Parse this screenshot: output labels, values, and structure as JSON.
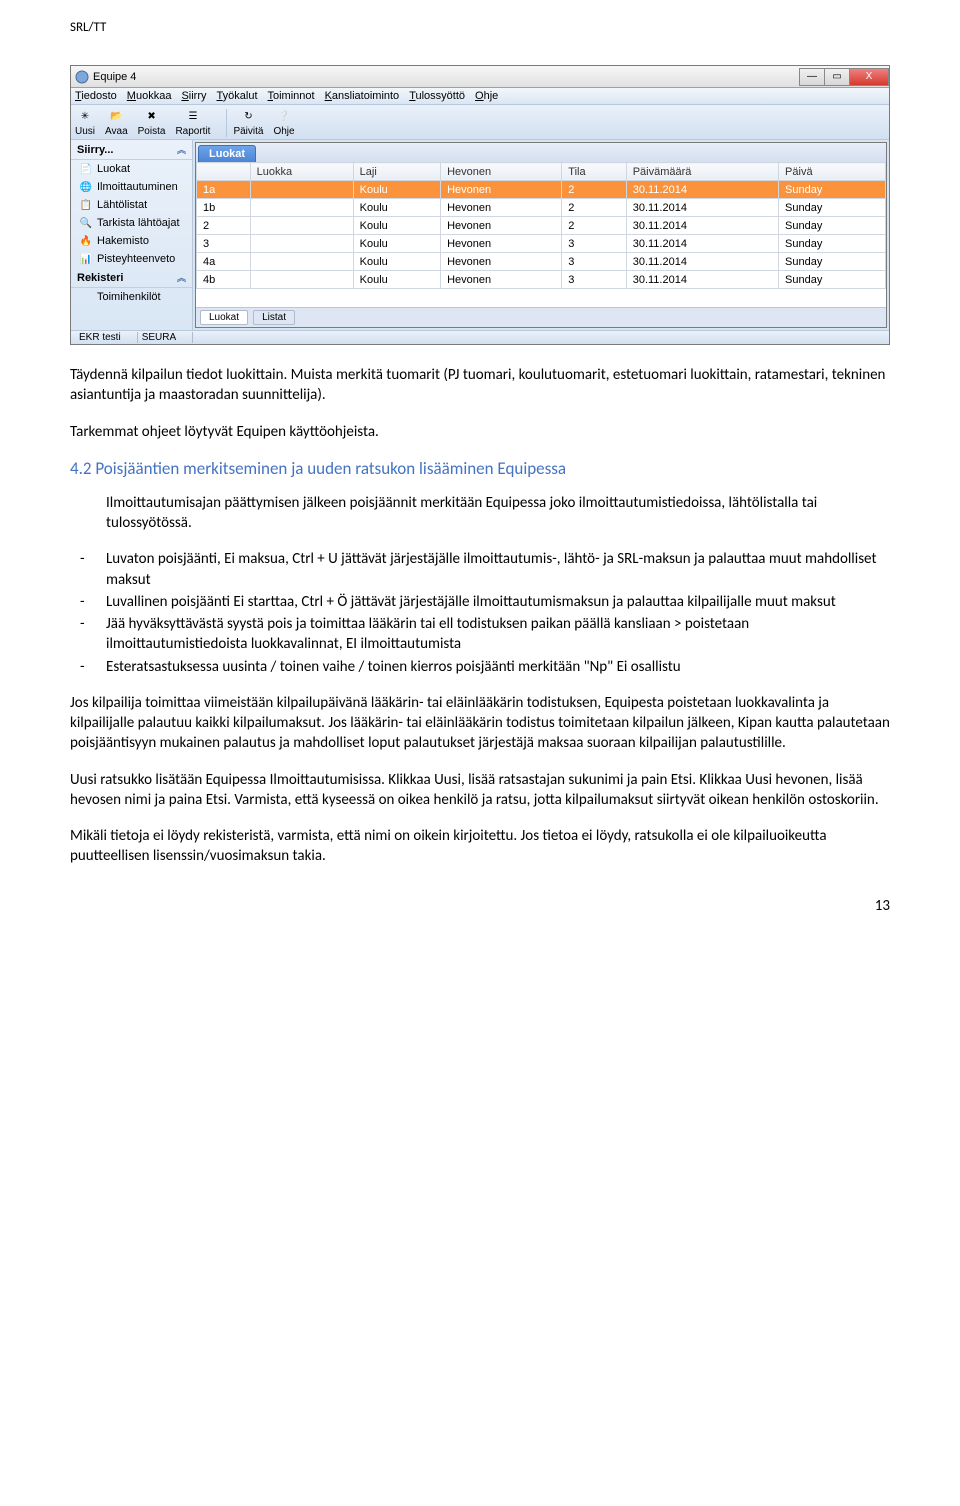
{
  "header_tag": "SRL/TT",
  "window": {
    "title": "Equipe 4",
    "min": "—",
    "max": "▭",
    "close": "X"
  },
  "menubar": [
    {
      "u": "T",
      "rest": "iedosto"
    },
    {
      "u": "M",
      "rest": "uokkaa"
    },
    {
      "u": "S",
      "rest": "iirry"
    },
    {
      "u": "T",
      "rest": "yökalut"
    },
    {
      "u": "T",
      "rest": "oiminnot"
    },
    {
      "u": "K",
      "rest": "ansliatoiminto"
    },
    {
      "u": "T",
      "rest": "ulossyöttö"
    },
    {
      "u": "O",
      "rest": "hje"
    }
  ],
  "toolbar": [
    {
      "label": "Uusi"
    },
    {
      "label": "Avaa"
    },
    {
      "label": "Poista"
    },
    {
      "label": "Raportit"
    },
    {
      "sep": true
    },
    {
      "label": "Päivitä"
    },
    {
      "label": "Ohje"
    }
  ],
  "sidebar": {
    "section1": {
      "title": "Siirry..."
    },
    "items1": [
      {
        "icon": "📄",
        "label": "Luokat"
      },
      {
        "icon": "🌐",
        "label": "Ilmoittautuminen"
      },
      {
        "icon": "📋",
        "label": "Lähtölistat"
      },
      {
        "icon": "🔍",
        "label": "Tarkista lähtöajat"
      },
      {
        "icon": "🔥",
        "label": "Hakemisto"
      },
      {
        "icon": "📊",
        "label": "Pisteyhteenveto"
      }
    ],
    "section2": {
      "title": "Rekisteri"
    },
    "items2": [
      {
        "icon": "",
        "label": "Toimihenkilöt"
      }
    ]
  },
  "main": {
    "tab": "Luokat",
    "footer_tabs": [
      "Luokat",
      "Listat"
    ],
    "columns": [
      "",
      "Luokka",
      "Laji",
      "Hevonen",
      "Tila",
      "Päivämäärä",
      "Päivä"
    ],
    "rows": [
      {
        "n": "1a",
        "luokka": "",
        "laji": "Koulu",
        "hev": "Hevonen",
        "tila": "2",
        "pvm": "30.11.2014",
        "paiva": "Sunday",
        "sel": true
      },
      {
        "n": "1b",
        "luokka": "",
        "laji": "Koulu",
        "hev": "Hevonen",
        "tila": "2",
        "pvm": "30.11.2014",
        "paiva": "Sunday"
      },
      {
        "n": "2",
        "luokka": "",
        "laji": "Koulu",
        "hev": "Hevonen",
        "tila": "2",
        "pvm": "30.11.2014",
        "paiva": "Sunday"
      },
      {
        "n": "3",
        "luokka": "",
        "laji": "Koulu",
        "hev": "Hevonen",
        "tila": "3",
        "pvm": "30.11.2014",
        "paiva": "Sunday"
      },
      {
        "n": "4a",
        "luokka": "",
        "laji": "Koulu",
        "hev": "Hevonen",
        "tila": "3",
        "pvm": "30.11.2014",
        "paiva": "Sunday"
      },
      {
        "n": "4b",
        "luokka": "",
        "laji": "Koulu",
        "hev": "Hevonen",
        "tila": "3",
        "pvm": "30.11.2014",
        "paiva": "Sunday"
      }
    ]
  },
  "statusbar": {
    "left": "EKR testi",
    "right": "SEURA"
  },
  "doc": {
    "p1": "Täydennä kilpailun tiedot luokittain. Muista merkitä tuomarit (PJ tuomari, koulutuomarit, estetuomari luokittain, ratamestari, tekninen asiantuntija ja maastoradan suunnittelija).",
    "p2": "Tarkemmat ohjeet löytyvät Equipen käyttöohjeista.",
    "h1": "4.2 Poisjääntien merkitseminen ja uuden ratsukon lisääminen Equipessa",
    "p3": "Ilmoittautumisajan päättymisen jälkeen poisjäännit merkitään Equipessa joko ilmoittautumistiedoissa, lähtölistalla tai tulossyötössä.",
    "li1": "Luvaton poisjäänti, Ei maksua, Ctrl + U jättävät järjestäjälle ilmoittautumis-, lähtö- ja SRL-maksun ja palauttaa muut mahdolliset maksut",
    "li2": "Luvallinen poisjäänti Ei starttaa, Ctrl + Ö jättävät järjestäjälle ilmoittautumismaksun ja palauttaa kilpailijalle muut maksut",
    "li3": "Jää hyväksyttävästä syystä pois ja toimittaa lääkärin tai ell todistuksen paikan päällä kansliaan > poistetaan ilmoittautumistiedoista luokkavalinnat, EI ilmoittautumista",
    "li4": "Esteratsastuksessa uusinta / toinen vaihe / toinen kierros poisjäänti merkitään \"Np\" Ei osallistu",
    "p4": "Jos kilpailija toimittaa viimeistään kilpailupäivänä lääkärin- tai eläinlääkärin todistuksen, Equipesta poistetaan luokkavalinta ja kilpailijalle palautuu kaikki kilpailumaksut. Jos lääkärin- tai eläinlääkärin todistus toimitetaan kilpailun jälkeen, Kipan kautta palautetaan poisjääntisyyn mukainen palautus ja mahdolliset loput palautukset järjestäjä maksaa suoraan kilpailijan palautustilille.",
    "p5": "Uusi ratsukko lisätään Equipessa Ilmoittautumisissa. Klikkaa Uusi, lisää ratsastajan sukunimi ja pain Etsi. Klikkaa Uusi hevonen, lisää hevosen nimi ja paina Etsi. Varmista, että kyseessä on oikea henkilö ja ratsu, jotta kilpailumaksut siirtyvät oikean henkilön ostoskoriin.",
    "p6": "Mikäli tietoja ei löydy rekisteristä, varmista, että nimi on oikein kirjoitettu. Jos tietoa ei löydy, ratsukolla ei ole kilpailuoikeutta puutteellisen lisenssin/vuosimaksun takia.",
    "page_num": "13"
  }
}
